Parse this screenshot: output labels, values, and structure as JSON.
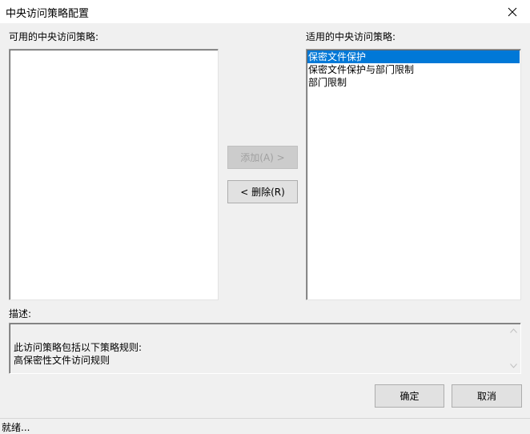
{
  "window": {
    "title": "中央访问策略配置",
    "close_icon": "close-icon"
  },
  "available": {
    "label": "可用的中央访问策略:",
    "items": []
  },
  "applied": {
    "label": "适用的中央访问策略:",
    "items": [
      "保密文件保护",
      "保密文件保护与部门限制",
      "部门限制"
    ],
    "selected_index": 0
  },
  "buttons": {
    "add": "添加(A) >",
    "remove": "< 删除(R)",
    "ok": "确定",
    "cancel": "取消"
  },
  "description": {
    "label": "描述:",
    "lines": [
      "此访问策略包括以下策略规则:",
      "高保密性文件访问规则"
    ]
  },
  "status": {
    "text": "就绪..."
  },
  "colors": {
    "selection": "#0078d7",
    "background": "#f0f0f0"
  }
}
